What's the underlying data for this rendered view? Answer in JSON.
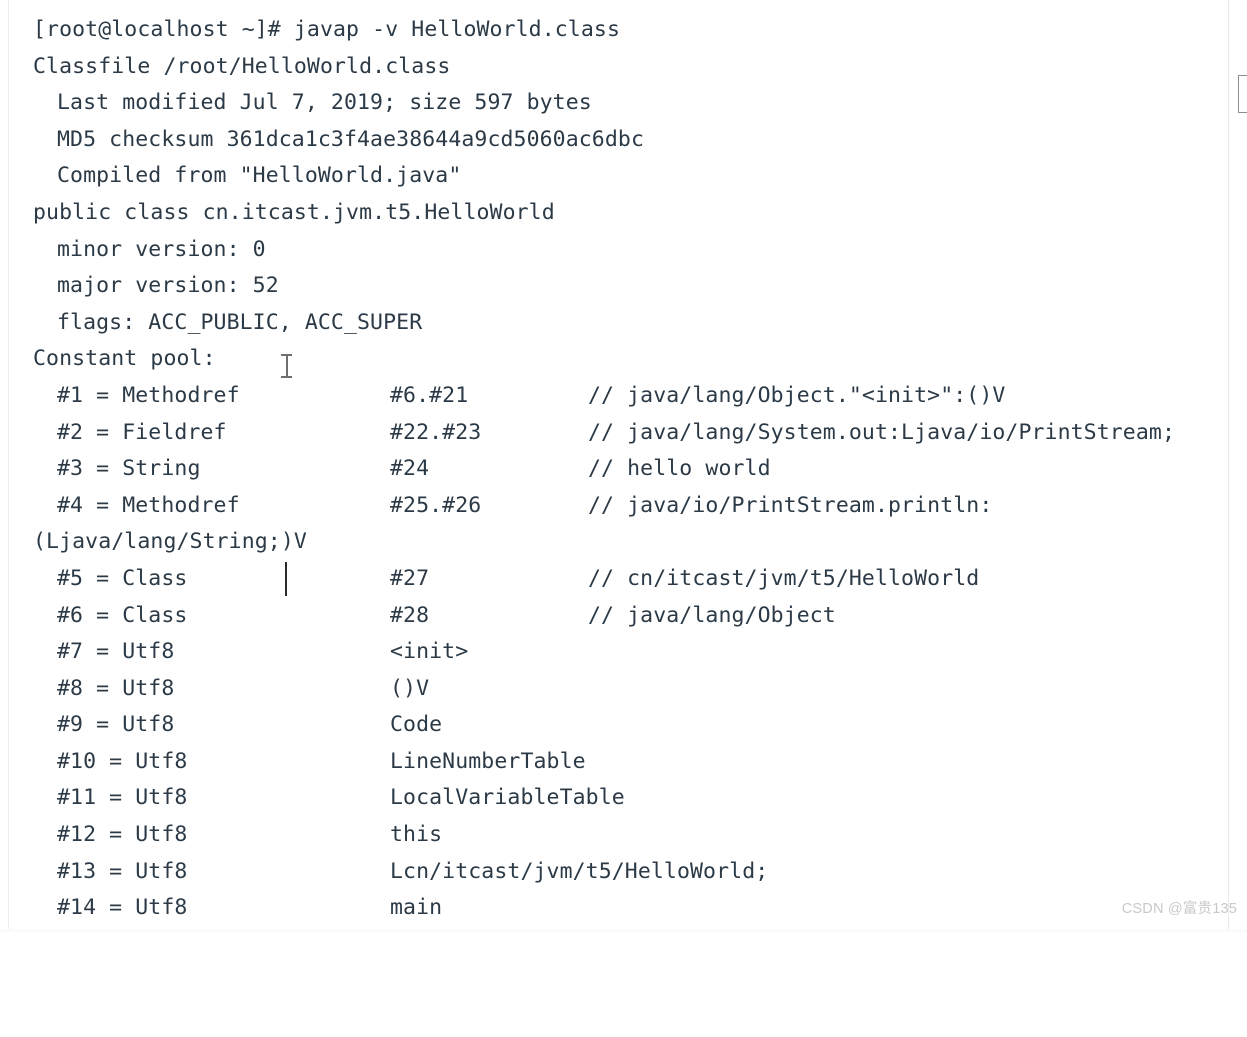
{
  "window": {
    "title": "javap -v HelloWorld.class",
    "text_color": "#2b3a46",
    "background_color": "#ffffff"
  },
  "terminal": {
    "prompt": "[root@localhost ~]#",
    "command": "javap -v HelloWorld.class",
    "prompt_line": "[root@localhost ~]# javap -v HelloWorld.class",
    "header_lines": [
      "Classfile /root/HelloWorld.class",
      "  Last modified Jul 7, 2019; size 597 bytes",
      "  MD5 checksum 361dca1c3f4ae38644a9cd5060ac6dbc",
      "  Compiled from \"HelloWorld.java\"",
      "public class cn.itcast.jvm.t5.HelloWorld",
      "  minor version: 0",
      "  major version: 52",
      "  flags: ACC_PUBLIC, ACC_SUPER",
      "Constant pool:"
    ],
    "classfile_path": "/root/HelloWorld.class",
    "last_modified": "Jul 7, 2019",
    "size_bytes": "597",
    "md5_checksum": "361dca1c3f4ae38644a9cd5060ac6dbc",
    "compiled_from": "HelloWorld.java",
    "class_declaration": "public class cn.itcast.jvm.t5.HelloWorld",
    "minor_version": "0",
    "major_version": "52",
    "flags": "ACC_PUBLIC, ACC_SUPER",
    "constant_pool_label": "Constant pool:",
    "constant_pool": [
      {
        "index": "#1",
        "eq": "=",
        "type": "Methodref",
        "ref": "#6.#21",
        "comment": "// java/lang/Object.\"<init>\":()V"
      },
      {
        "index": "#2",
        "eq": "=",
        "type": "Fieldref",
        "ref": "#22.#23",
        "comment": "// java/lang/System.out:Ljava/io/PrintStream;"
      },
      {
        "index": "#3",
        "eq": "=",
        "type": "String",
        "ref": "#24",
        "comment": "// hello world"
      },
      {
        "index": "#4",
        "eq": "=",
        "type": "Methodref",
        "ref": "#25.#26",
        "comment": "// java/io/PrintStream.println:"
      },
      {
        "index": "#5",
        "eq": "=",
        "type": "Class",
        "ref": "#27",
        "comment": "// cn/itcast/jvm/t5/HelloWorld"
      },
      {
        "index": "#6",
        "eq": "=",
        "type": "Class",
        "ref": "#28",
        "comment": "// java/lang/Object"
      },
      {
        "index": "#7",
        "eq": "=",
        "type": "Utf8",
        "ref": "<init>",
        "comment": ""
      },
      {
        "index": "#8",
        "eq": "=",
        "type": "Utf8",
        "ref": "()V",
        "comment": ""
      },
      {
        "index": "#9",
        "eq": "=",
        "type": "Utf8",
        "ref": "Code",
        "comment": ""
      },
      {
        "index": "#10",
        "eq": "=",
        "type": "Utf8",
        "ref": "LineNumberTable",
        "comment": ""
      },
      {
        "index": "#11",
        "eq": "=",
        "type": "Utf8",
        "ref": "LocalVariableTable",
        "comment": ""
      },
      {
        "index": "#12",
        "eq": "=",
        "type": "Utf8",
        "ref": "this",
        "comment": ""
      },
      {
        "index": "#13",
        "eq": "=",
        "type": "Utf8",
        "ref": "Lcn/itcast/jvm/t5/HelloWorld;",
        "comment": ""
      },
      {
        "index": "#14",
        "eq": "=",
        "type": "Utf8",
        "ref": "main",
        "comment": ""
      }
    ],
    "wrapped_continuation": "(Ljava/lang/String;)V"
  },
  "lines": {
    "l01": "[root@localhost ~]# javap -v HelloWorld.class",
    "l02": "Classfile /root/HelloWorld.class",
    "l03": "Last modified Jul 7, 2019; size 597 bytes",
    "l04": "MD5 checksum 361dca1c3f4ae38644a9cd5060ac6dbc",
    "l05": "Compiled from \"HelloWorld.java\"",
    "l06": "public class cn.itcast.jvm.t5.HelloWorld",
    "l07": "minor version: 0",
    "l08": "major version: 52",
    "l09": "flags: ACC_PUBLIC, ACC_SUPER",
    "l10": "Constant pool:",
    "l11a": "#1 = Methodref",
    "l11b": "#6.#21",
    "l11c": "// java/lang/Object.\"<init>\":()V",
    "l12a": "#2 = Fieldref",
    "l12b": "#22.#23",
    "l12c": "// java/lang/System.out:Ljava/io/PrintStream;",
    "l13a": "#3 = String",
    "l13b": "#24",
    "l13c": "// hello world",
    "l14a": "#4 = Methodref",
    "l14b": "#25.#26",
    "l14c": "// java/io/PrintStream.println:",
    "l15": "(Ljava/lang/String;)V",
    "l16a": "#5 = Class",
    "l16b": "#27",
    "l16c": "// cn/itcast/jvm/t5/HelloWorld",
    "l17a": "#6 = Class",
    "l17b": "#28",
    "l17c": "// java/lang/Object",
    "l18a": "#7 = Utf8",
    "l18b": "<init>",
    "l19a": "#8 = Utf8",
    "l19b": "()V",
    "l20a": "#9 = Utf8",
    "l20b": "Code",
    "l21a": "#10 = Utf8",
    "l21b": "LineNumberTable",
    "l22a": "#11 = Utf8",
    "l22b": "LocalVariableTable",
    "l23a": "#12 = Utf8",
    "l23b": "this",
    "l24a": "#13 = Utf8",
    "l24b": "Lcn/itcast/jvm/t5/HelloWorld;",
    "l25a": "#14 = Utf8",
    "l25b": "main"
  },
  "cursor": {
    "caret_visible": "true",
    "mouse_pointer": "i-beam"
  },
  "watermark": {
    "text": "CSDN @富贵135",
    "color": "#c9c9c9"
  }
}
